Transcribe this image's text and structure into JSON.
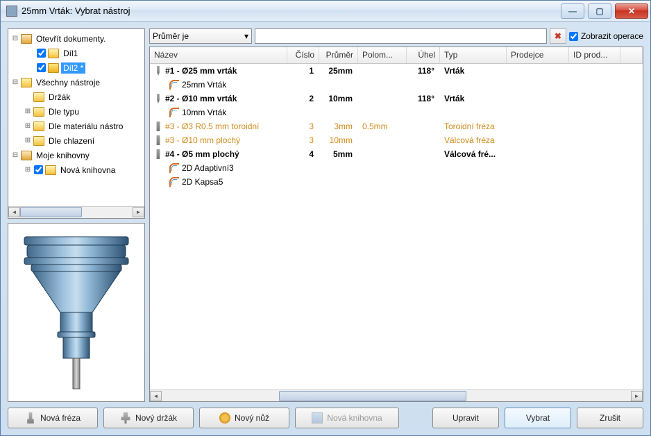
{
  "titlebar": {
    "title": "25mm Vrták: Vybrat nástroj"
  },
  "tree": {
    "root1": "Otevřít dokumenty.",
    "dil1": "Díl1",
    "dil2": "Díl2 *",
    "allTools": "Všechny nástroje",
    "holder": "Držák",
    "byType": "Dle typu",
    "byMaterial": "Dle materiálu nástro",
    "byCooling": "Dle chlazení",
    "myLibs": "Moje knihovny",
    "newLib": "Nová knihovna"
  },
  "filter": {
    "select": "Průměr je",
    "showOpsLabel": "Zobrazit operace"
  },
  "columns": {
    "name": "Název",
    "num": "Číslo",
    "dia": "Průměr",
    "rad": "Polom...",
    "ang": "Úhel",
    "typ": "Typ",
    "ven": "Prodejce",
    "id": "ID prod..."
  },
  "rows": [
    {
      "name": "#1 - Ø25 mm vrták",
      "num": "1",
      "dia": "25mm",
      "rad": "",
      "ang": "118°",
      "typ": "Vrták",
      "bold": true,
      "icon": "drill"
    },
    {
      "name": "25mm Vrták",
      "sub": true,
      "op": true
    },
    {
      "name": "#2 - Ø10 mm vrták",
      "num": "2",
      "dia": "10mm",
      "rad": "",
      "ang": "118°",
      "typ": "Vrták",
      "bold": true,
      "icon": "drill"
    },
    {
      "name": "10mm Vrták",
      "sub": true,
      "op": true
    },
    {
      "name": "#3 - Ø3 R0.5 mm toroidní",
      "num": "3",
      "dia": "3mm",
      "rad": "0.5mm",
      "ang": "",
      "typ": "Toroidní fréza",
      "orange": true,
      "icon": "mill"
    },
    {
      "name": "#3 - Ø10 mm plochý",
      "num": "3",
      "dia": "10mm",
      "rad": "",
      "ang": "",
      "typ": "Válcová fréza",
      "orange": true,
      "icon": "mill"
    },
    {
      "name": "#4 - Ø5 mm plochý",
      "num": "4",
      "dia": "5mm",
      "rad": "",
      "ang": "",
      "typ": "Válcová fré...",
      "bold": true,
      "icon": "mill"
    },
    {
      "name": "2D Adaptivní3",
      "sub": true,
      "op": true
    },
    {
      "name": "2D Kapsa5",
      "sub": true,
      "op": true
    }
  ],
  "buttons": {
    "newMill": "Nová fréza",
    "newHolder": "Nový držák",
    "newKnife": "Nový nůž",
    "newLib": "Nová knihovna",
    "edit": "Upravit",
    "select": "Vybrat",
    "cancel": "Zrušit"
  }
}
